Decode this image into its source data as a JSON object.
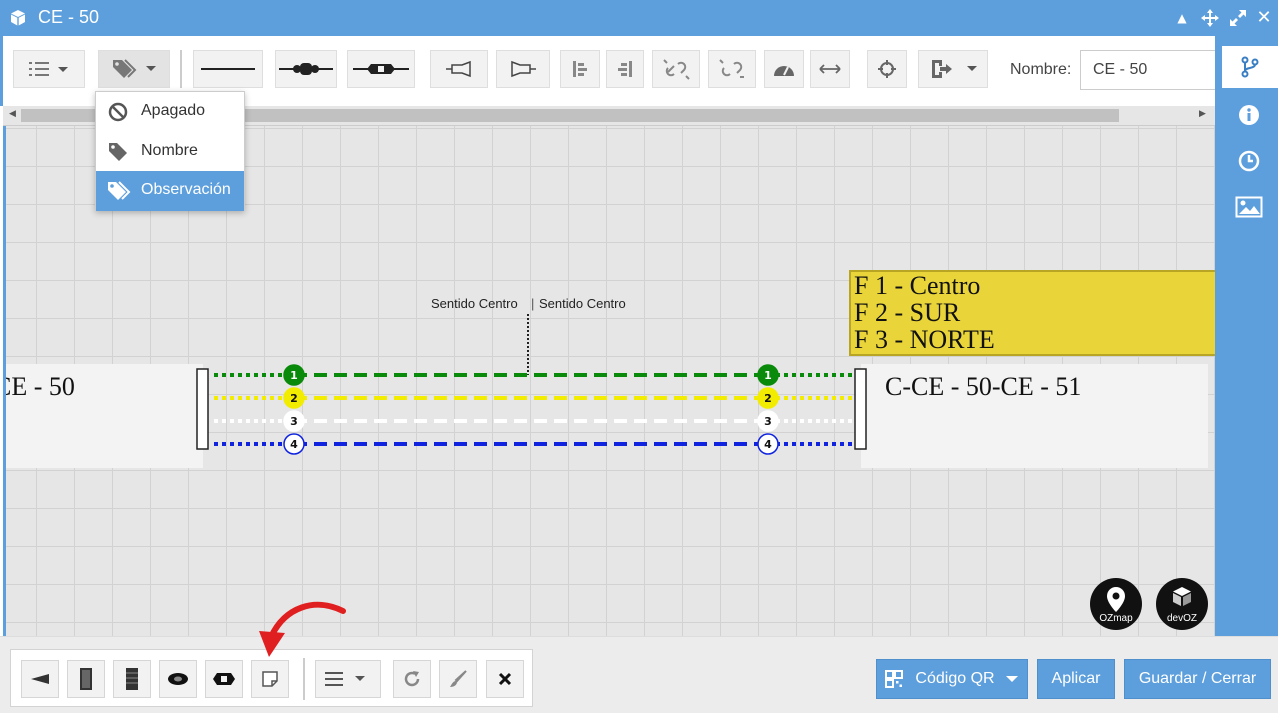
{
  "window": {
    "title": "CE - 50"
  },
  "toolbar": {
    "nombre_label": "Nombre:",
    "nombre_value": "CE - 50"
  },
  "label_dropdown": {
    "items": [
      {
        "label": "Apagado",
        "icon": "ban-icon",
        "selected": false
      },
      {
        "label": "Nombre",
        "icon": "tag-icon",
        "selected": false
      },
      {
        "label": "Observación",
        "icon": "tags-icon",
        "selected": true
      }
    ]
  },
  "diagram": {
    "left_cable_name": "CE - 50",
    "right_cable_name": "C-CE - 50-CE - 51",
    "note_lines": [
      "F 1 - Centro",
      "F 2 - SUR",
      "F 3 - NORTE"
    ],
    "sentido_left": "Sentido Centro",
    "sentido_right": "Sentido Centro",
    "fibers": [
      {
        "number": "1",
        "color": "#0a8a0a"
      },
      {
        "number": "2",
        "color": "#f2ec00"
      },
      {
        "number": "3",
        "color": "#ffffff"
      },
      {
        "number": "4",
        "color": "#1024e0"
      }
    ]
  },
  "logos": {
    "ozmap": "OZmap",
    "devoz": "devOZ"
  },
  "bottom": {
    "qr_label": "Código QR",
    "apply_label": "Aplicar",
    "save_close_label": "Guardar / Cerrar"
  },
  "colors": {
    "accent": "#5d9fdc",
    "note_bg": "#e9d53a",
    "annotation_arrow": "#e02020"
  }
}
